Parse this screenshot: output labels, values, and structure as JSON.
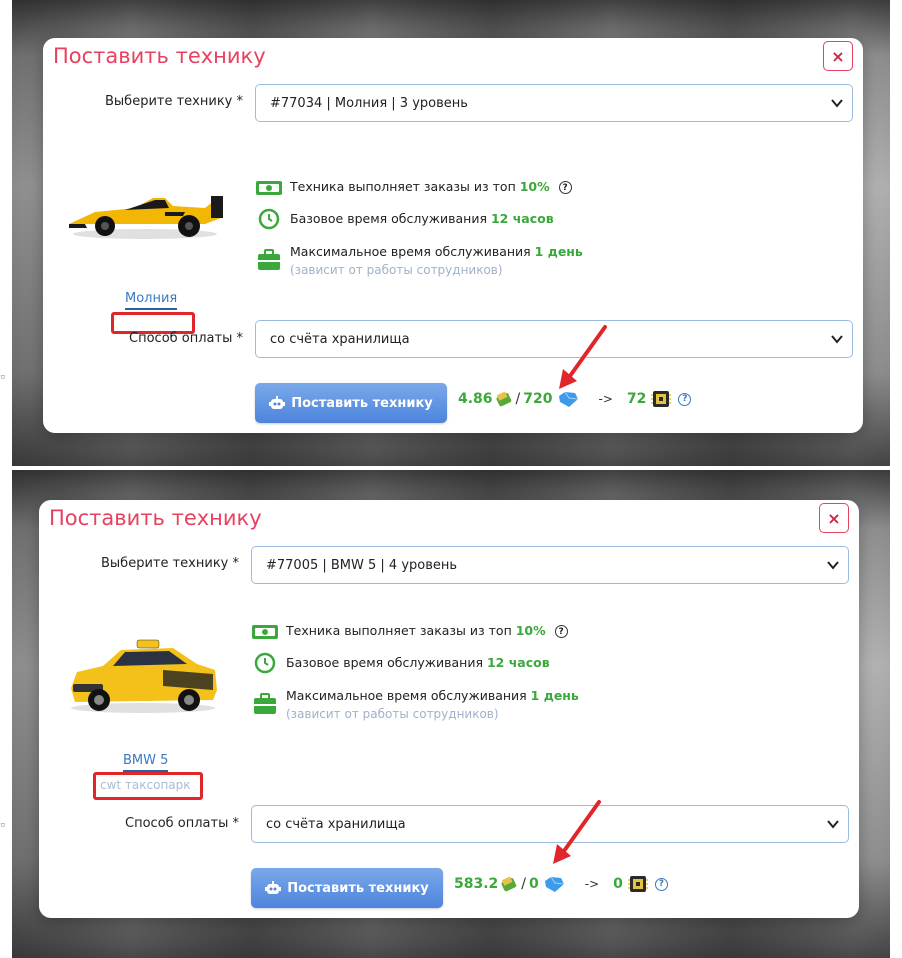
{
  "panels": [
    {
      "modal_title": "Поставить технику",
      "close_label": "×",
      "select_label": "Выберите технику *",
      "select_value": "#77034 | Молния | 3 уровень",
      "car_name": "Молния",
      "car_subtitle": "",
      "info": {
        "orders_text": "Техника выполняет заказы из топ",
        "orders_value": "10%",
        "base_time_text": "Базовое время обслуживания",
        "base_time_value": "12 часов",
        "max_time_text": "Максимальное время обслуживания",
        "max_time_value": "1 день",
        "max_time_note": "(зависит от работы сотрудников)"
      },
      "payment_label": "Способ оплаты *",
      "payment_value": "со счёта хранилища",
      "submit_label": "Поставить технику",
      "price": {
        "money": "4.86",
        "slash": "/",
        "gems": "720",
        "arrow": "->",
        "chips": "72",
        "help": "?"
      }
    },
    {
      "modal_title": "Поставить технику",
      "close_label": "×",
      "select_label": "Выберите технику *",
      "select_value": "#77005 | BMW 5 | 4 уровень",
      "car_name": "BMW 5",
      "car_subtitle": "cwt таксопарк",
      "info": {
        "orders_text": "Техника выполняет заказы из топ",
        "orders_value": "10%",
        "base_time_text": "Базовое время обслуживания",
        "base_time_value": "12 часов",
        "max_time_text": "Максимальное время обслуживания",
        "max_time_value": "1 день",
        "max_time_note": "(зависит от работы сотрудников)"
      },
      "payment_label": "Способ оплаты *",
      "payment_value": "со счёта хранилища",
      "submit_label": "Поставить технику",
      "price": {
        "money": "583.2",
        "slash": "/",
        "gems": "0",
        "arrow": "->",
        "chips": "0",
        "help": "?"
      }
    }
  ],
  "colors": {
    "title": "#e8415f",
    "accent_green": "#3aa83a",
    "button_blue": "#4d84dc",
    "highlight_red": "#e0262b",
    "link_blue": "#3a78c3"
  },
  "icons": [
    "money-icon",
    "clock-icon",
    "briefcase-icon",
    "help-icon",
    "robot-icon",
    "money-bag-icon",
    "gem-icon",
    "chip-icon",
    "chevron-down-icon",
    "close-icon"
  ]
}
